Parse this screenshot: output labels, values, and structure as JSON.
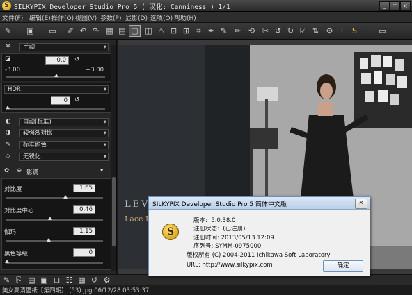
{
  "window": {
    "title": "SILKYPIX Developer Studio Pro 5 ( 汉化: Canniness )    1/1"
  },
  "menu": [
    "文件(F)",
    "编辑(E)",
    "操作(O)",
    "视图(V)",
    "参数(P)",
    "显影(D)",
    "选项(O)",
    "帮助(H)"
  ],
  "panel": {
    "mode": "手动",
    "exposure_value": "0.0",
    "exposure_min": "-3.00",
    "exposure_max": "+3.00",
    "hdr_label": "HDR",
    "hdr_value": "0",
    "wb_mode": "自动(标准)",
    "tone_mode": "较强烈对比",
    "color_mode": "标准颜色",
    "sharp_mode": "无锐化",
    "tone_section_label": "影调",
    "contrast_label": "对比度",
    "contrast_value": "1.65",
    "contrast_center_label": "对比度中心",
    "contrast_center_value": "0.46",
    "gamma_label": "伽玛",
    "gamma_value": "1.15",
    "black_level_label": "黑色等级",
    "black_level_value": "0"
  },
  "viewer": {
    "brand_text": "LEV",
    "sub_text": "Lace D"
  },
  "status": {
    "text": "美女高清壁纸【第四期】 (53).jpg 06/12/28 03:53:37"
  },
  "about_dialog": {
    "title": "SILKYPIX Developer Studio Pro 5 简体中文版",
    "version_label": "版本:",
    "version": "5.0.38.0",
    "reg_status_label": "注册状态:",
    "reg_status": "(已注册)",
    "reg_time_label": "注册时间:",
    "reg_time": "2013/05/13 12:09",
    "serial_label": "序列号:",
    "serial": "SYMM-0975000",
    "copyright": "版权所有 (C) 2004-2011 Ichikawa Soft Laboratory",
    "url_label": "URL:",
    "url": "http://www.silkypix.com",
    "ok_label": "确定"
  }
}
